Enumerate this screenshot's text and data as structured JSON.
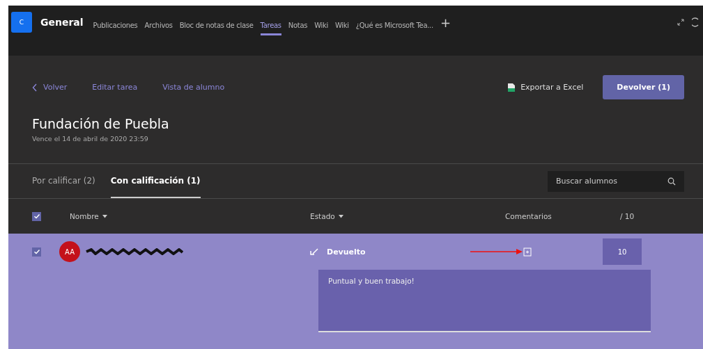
{
  "team_tile": "C",
  "channel": "General",
  "tabs": [
    {
      "label": "Publicaciones",
      "selected": false
    },
    {
      "label": "Archivos",
      "selected": false
    },
    {
      "label": "Bloc de notas de clase",
      "selected": false
    },
    {
      "label": "Tareas",
      "selected": true
    },
    {
      "label": "Notas",
      "selected": false
    },
    {
      "label": "Wiki",
      "selected": false
    },
    {
      "label": "Wiki",
      "selected": false
    },
    {
      "label": "¿Qué es Microsoft Tea...",
      "selected": false
    }
  ],
  "add_tab": "+",
  "back_link": "Volver",
  "nav_links": [
    "Editar tarea",
    "Vista de alumno"
  ],
  "export": "Exportar a Excel",
  "return_button": "Devolver (1)",
  "assignment": {
    "title": "Fundación de Puebla",
    "due": "Vence el 14 de abril de 2020 23:59"
  },
  "filter_tabs": [
    {
      "label": "Por calificar (2)",
      "selected": false
    },
    {
      "label": "Con calificación (1)",
      "selected": true
    }
  ],
  "search": {
    "placeholder": "Buscar alumnos"
  },
  "select_all": {
    "checked": true
  },
  "columns": {
    "name": "Nombre",
    "status": "Estado",
    "comments": "Comentarios",
    "points": "/ 10"
  },
  "rows": [
    {
      "checked": true,
      "selected": true,
      "initials": "AA",
      "status": "Devuelto",
      "score": "10",
      "feedback": "Puntual y buen trabajo!"
    }
  ]
}
